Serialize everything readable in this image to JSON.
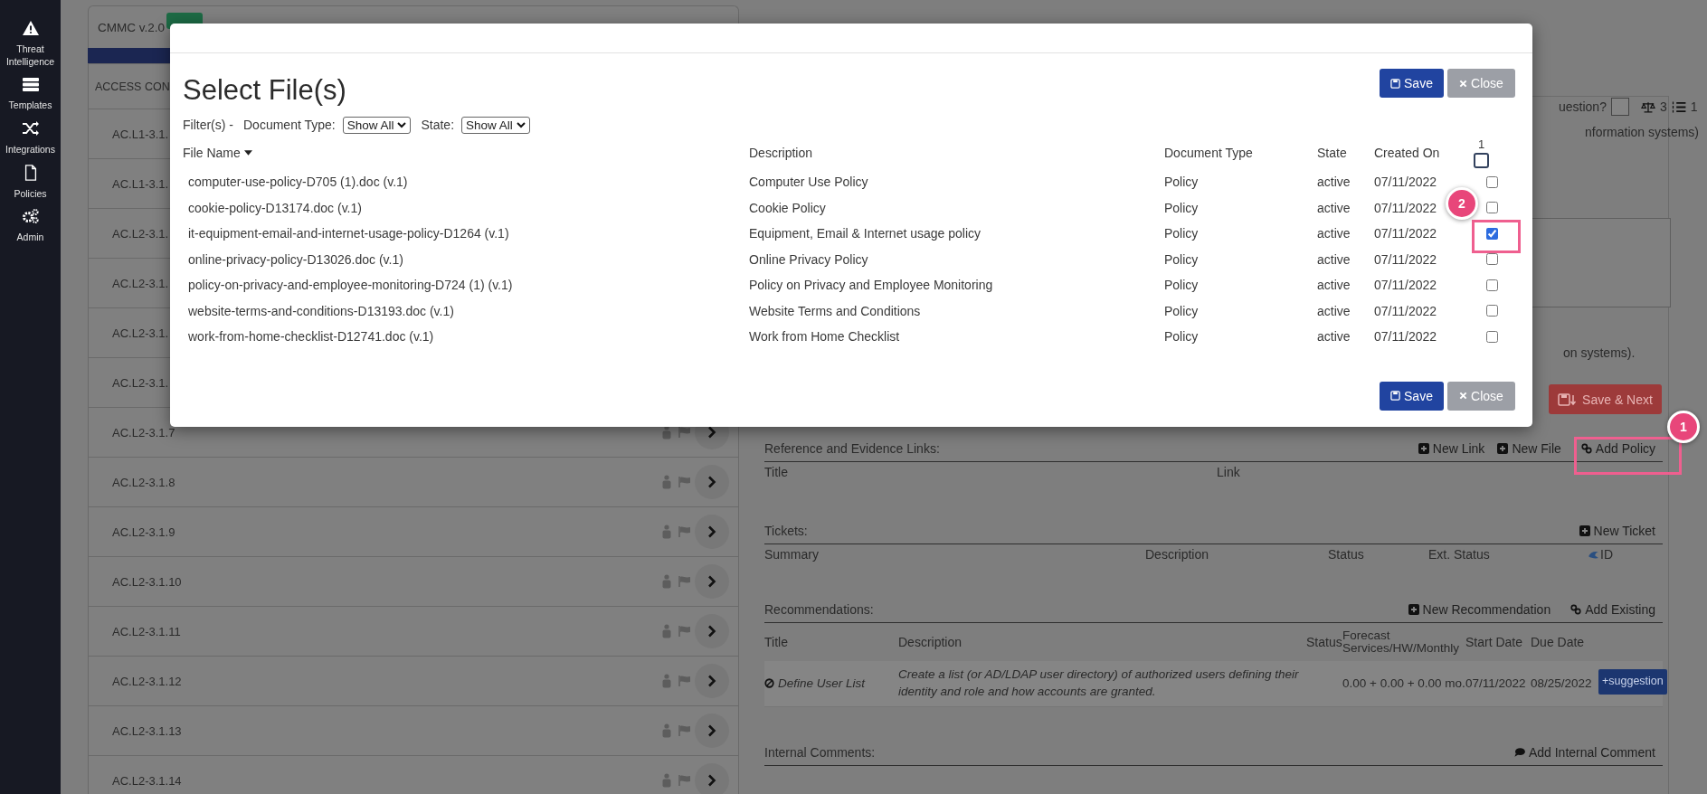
{
  "sidebar": {
    "items": [
      {
        "label": "Threat Intelligence"
      },
      {
        "label": "Templates"
      },
      {
        "label": "Integrations"
      },
      {
        "label": "Policies"
      },
      {
        "label": "Admin"
      }
    ]
  },
  "framework": {
    "title": "CMMC v.2.0",
    "domain": "ACCESS CON"
  },
  "controls": [
    "AC.L1-3.1.",
    "AC.L1-3.1.",
    "AC.L2-3.1.",
    "AC.L2-3.1.",
    "AC.L2-3.1.",
    "AC.L2-3.1.",
    "AC.L2-3.1.7",
    "AC.L2-3.1.8",
    "AC.L2-3.1.9",
    "AC.L2-3.1.10",
    "AC.L2-3.1.11",
    "AC.L2-3.1.12",
    "AC.L2-3.1.13",
    "AC.L2-3.1.14"
  ],
  "question_bar": {
    "label": "uestion?",
    "checked": false,
    "weight": "3",
    "count": "1"
  },
  "text_fragments": [
    "nformation systems)",
    "on systems)."
  ],
  "save_next_button": "Save & Next",
  "reference_links": {
    "title": "Reference and Evidence Links:",
    "actions": [
      {
        "kind": "new",
        "label": "New Link"
      },
      {
        "kind": "new",
        "label": "New File"
      },
      {
        "kind": "link",
        "label": "Add Policy"
      }
    ],
    "columns": [
      "Title",
      "Link"
    ]
  },
  "tickets": {
    "title": "Tickets:",
    "actions": [
      {
        "kind": "new",
        "label": "New Ticket"
      }
    ],
    "columns": [
      "Summary",
      "Description",
      "Status",
      "Ext. Status",
      "ID"
    ]
  },
  "recommendations": {
    "title": "Recommendations:",
    "actions": [
      {
        "kind": "new",
        "label": "New Recommendation"
      },
      {
        "kind": "link",
        "label": "Add Existing"
      }
    ],
    "columns": [
      "Title",
      "Description",
      "Status",
      "Forecast Services/HW/Monthly",
      "Start Date",
      "Due Date"
    ],
    "rows": [
      {
        "title": "Define User List",
        "description": "Create a list (or AD/LDAP user directory) of authorized users defining their identity and role and how accounts are granted.",
        "forecast": "0.00 + 0.00 + 0.00 mo.",
        "start_date": "07/11/2022",
        "due_date": "08/25/2022",
        "action": "+suggestion"
      }
    ]
  },
  "internal_comments": {
    "title": "Internal Comments:",
    "actions": [
      {
        "kind": "comment",
        "label": "Add Internal Comment"
      }
    ]
  },
  "modal": {
    "title": "Select File(s)",
    "top_buttons": {
      "save": "Save",
      "close": "Close"
    },
    "bottom_buttons": {
      "save": "Save",
      "close": "Close"
    },
    "filter_label": "Filter(s) -",
    "filters": [
      {
        "label": "Document Type:",
        "value": "Show All"
      },
      {
        "label": "State:",
        "value": "Show All"
      }
    ],
    "columns": [
      "File Name",
      "Description",
      "Document Type",
      "State",
      "Created On"
    ],
    "selected_count": "1",
    "select_all_checked": false,
    "files": [
      {
        "name": "computer-use-policy-D705 (1).doc (v.1)",
        "description": "Computer Use Policy",
        "type": "Policy",
        "state": "active",
        "created": "07/11/2022",
        "checked": false
      },
      {
        "name": "cookie-policy-D13174.doc (v.1)",
        "description": "Cookie Policy",
        "type": "Policy",
        "state": "active",
        "created": "07/11/2022",
        "checked": false
      },
      {
        "name": "it-equipment-email-and-internet-usage-policy-D1264 (v.1)",
        "description": "Equipment, Email & Internet usage policy",
        "type": "Policy",
        "state": "active",
        "created": "07/11/2022",
        "checked": true
      },
      {
        "name": "online-privacy-policy-D13026.doc (v.1)",
        "description": "Online Privacy Policy",
        "type": "Policy",
        "state": "active",
        "created": "07/11/2022",
        "checked": false
      },
      {
        "name": "policy-on-privacy-and-employee-monitoring-D724 (1) (v.1)",
        "description": "Policy on Privacy and Employee Monitoring",
        "type": "Policy",
        "state": "active",
        "created": "07/11/2022",
        "checked": false
      },
      {
        "name": "website-terms-and-conditions-D13193.doc (v.1)",
        "description": "Website Terms and Conditions",
        "type": "Policy",
        "state": "active",
        "created": "07/11/2022",
        "checked": false
      },
      {
        "name": "work-from-home-checklist-D12741.doc (v.1)",
        "description": "Work from Home Checklist",
        "type": "Policy",
        "state": "active",
        "created": "07/11/2022",
        "checked": false
      }
    ]
  },
  "annotations": [
    {
      "number": "1"
    },
    {
      "number": "2"
    }
  ]
}
